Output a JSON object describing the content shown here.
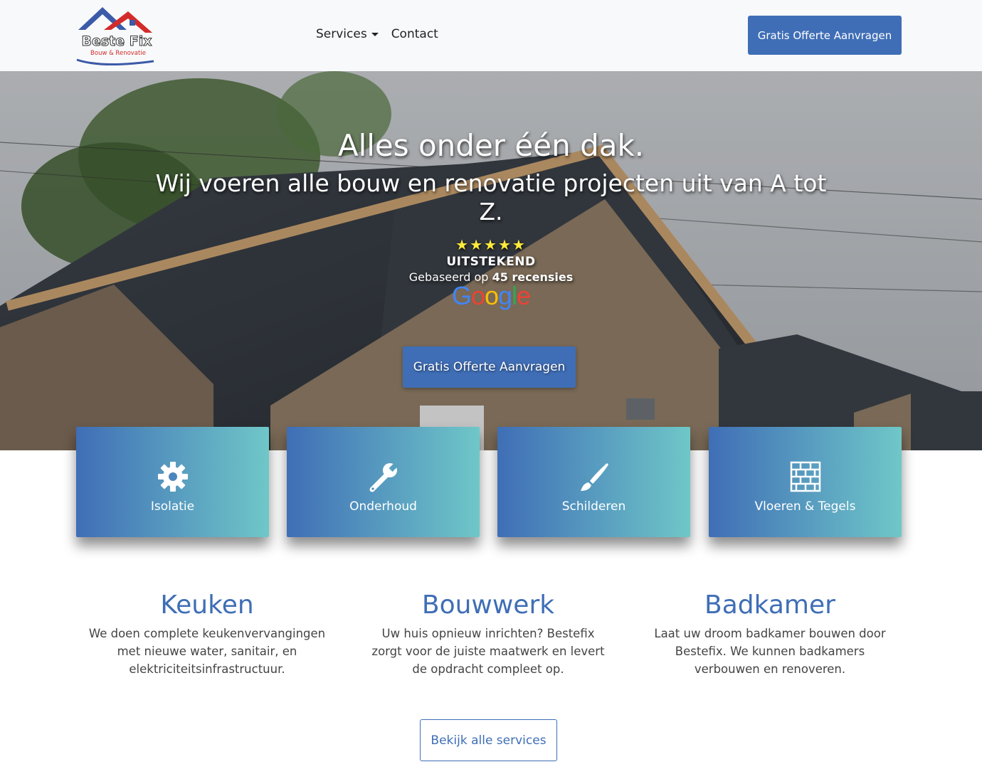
{
  "brand": {
    "name": "Beste Fix",
    "tagline": "Bouw & Renovatie"
  },
  "nav": {
    "items": [
      {
        "label": "Services",
        "dropdown": true
      },
      {
        "label": "Contact",
        "dropdown": false
      }
    ],
    "cta_label": "Gratis Offerte Aanvragen"
  },
  "hero": {
    "title": "Alles onder één dak.",
    "subtitle": "Wij voeren alle bouw en renovatie projecten uit van A tot Z.",
    "stars": "★★★★★",
    "rating_label": "UITSTEKEND",
    "rating_prefix": "Gebaseerd op",
    "rating_count": "45 recensies",
    "review_source": "Google",
    "cta_label": "Gratis Offerte Aanvragen"
  },
  "services": [
    {
      "label": "Isolatie",
      "icon": "gear-icon"
    },
    {
      "label": "Onderhoud",
      "icon": "wrench-icon"
    },
    {
      "label": "Schilderen",
      "icon": "paintbrush-icon"
    },
    {
      "label": "Vloeren & Tegels",
      "icon": "brick-wall-icon"
    }
  ],
  "features": [
    {
      "title": "Keuken",
      "text": "We doen complete keukenvervangingen met nieuwe water, sanitair, en elektriciteitsinfrastructuur."
    },
    {
      "title": "Bouwwerk",
      "text": "Uw huis opnieuw inrichten? Bestefix zorgt voor de juiste maatwerk en levert de opdracht compleet op."
    },
    {
      "title": "Badkamer",
      "text": "Laat uw droom badkamer bouwen door Bestefix. We kunnen badkamers verbouwen en renoveren."
    }
  ],
  "all_services_label": "Bekijk alle services",
  "colors": {
    "primary": "#3f6eb6",
    "gradient_end": "#6fc7c8",
    "star": "#ffeb3b",
    "navbar_bg": "#f8f9fa"
  }
}
